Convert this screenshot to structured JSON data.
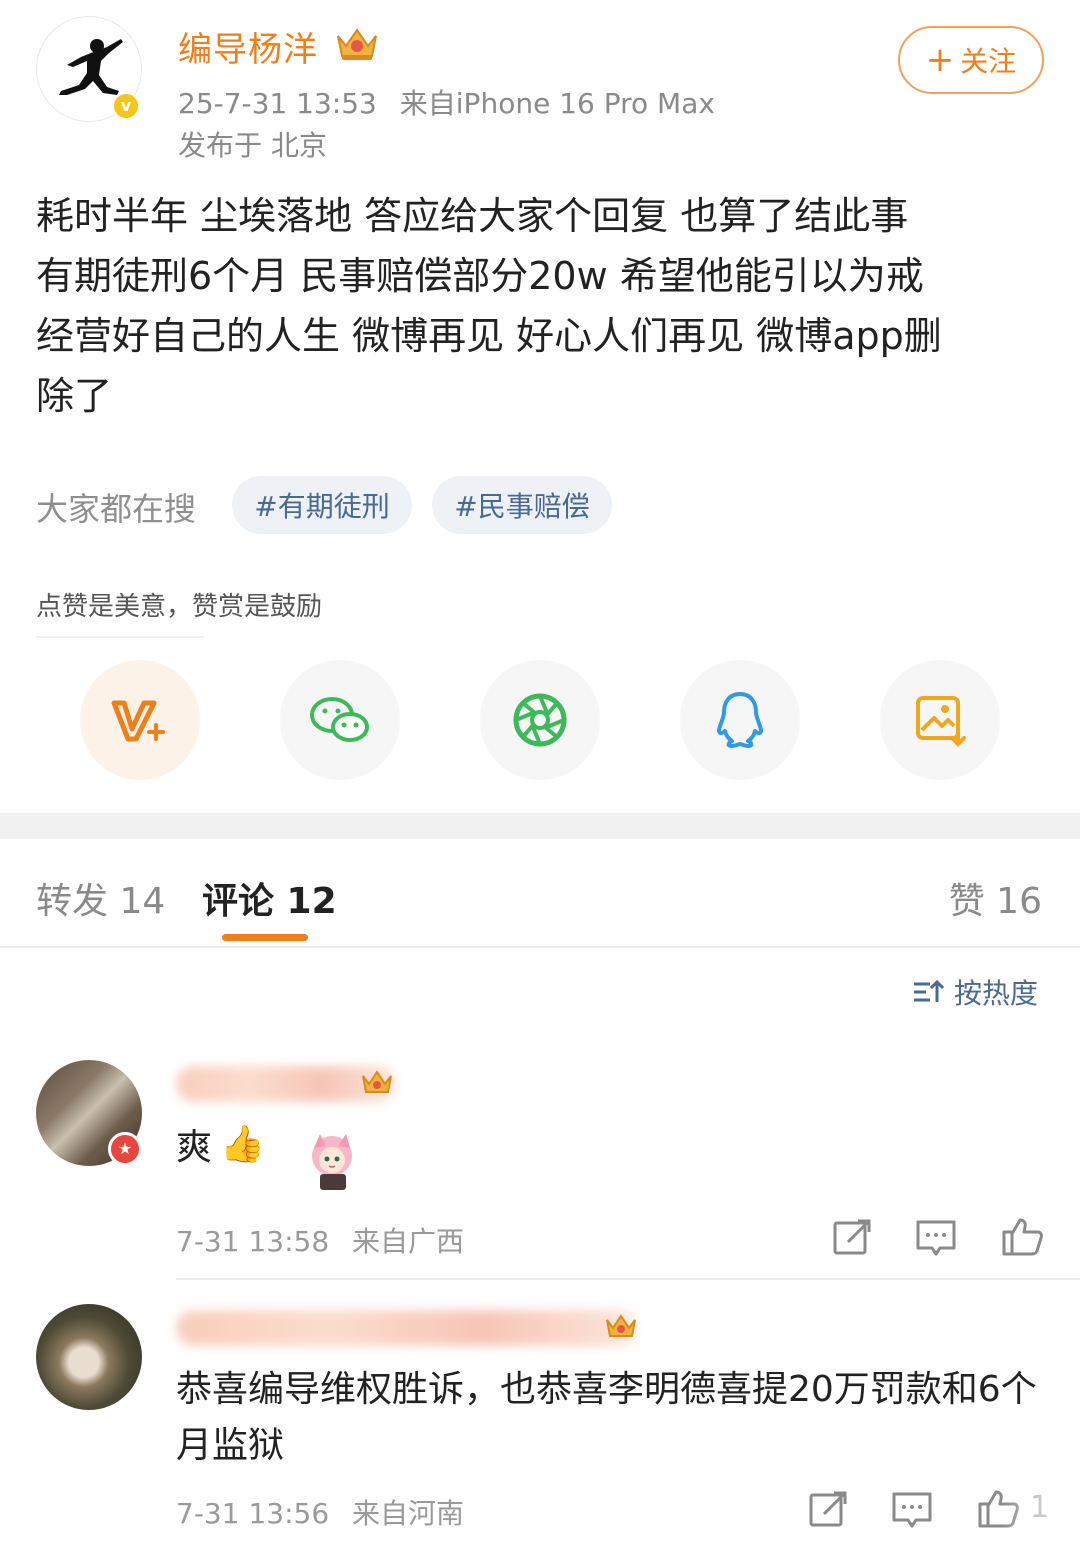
{
  "post": {
    "author_name": "编导杨洋",
    "timestamp": "25-7-31 13:53",
    "source": "来自iPhone 16 Pro Max",
    "location": "发布于 北京",
    "follow_label": "关注",
    "body_lines": [
      "耗时半年 尘埃落地 答应给大家个回复 也算了结此事",
      "有期徒刑6个月 民事赔偿部分20w 希望他能引以为戒",
      "经营好自己的人生 微博再见 好心人们再见 微博app删",
      "除了"
    ]
  },
  "hot_search": {
    "label": "大家都在搜",
    "topics": [
      "#有期徒刑",
      "#民事赔偿"
    ]
  },
  "appreciation": {
    "text": "点赞是美意，赞赏是鼓励"
  },
  "share_icons": [
    "v-plus-icon",
    "wechat-icon",
    "moments-icon",
    "qq-icon",
    "save-image-icon"
  ],
  "tabs": {
    "repost": "转发 14",
    "comment": "评论 12",
    "like": "赞 16"
  },
  "sort": {
    "label": "按热度"
  },
  "comments": [
    {
      "text": "爽",
      "emoji": "👍",
      "time": "7-31 13:58",
      "source": "来自广西"
    },
    {
      "text": "恭喜编导维权胜诉，也恭喜李明德喜提20万罚款和6个月监狱",
      "time": "7-31 13:56",
      "source": "来自河南",
      "like_count": "1"
    }
  ],
  "colors": {
    "accent": "#f07e1a",
    "link": "#4a6a93",
    "muted": "#8a8a8a"
  }
}
